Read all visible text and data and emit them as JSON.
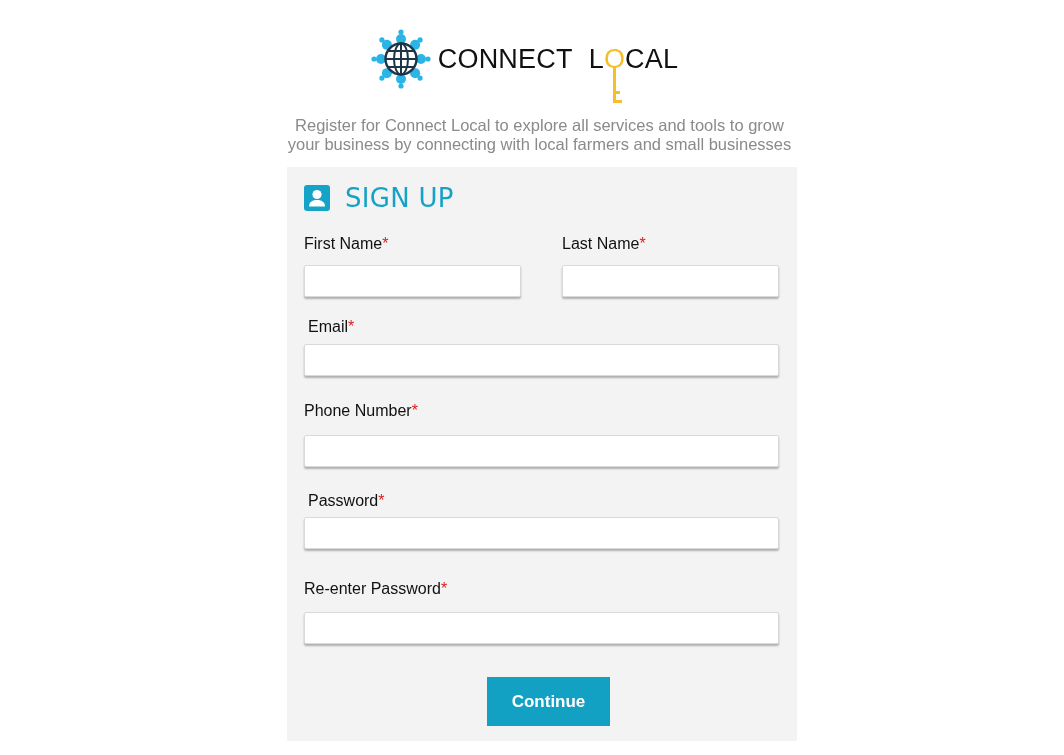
{
  "logo": {
    "first_word": "CONNECT",
    "second_word_parts": [
      {
        "kind": "plain",
        "text": "L"
      },
      {
        "kind": "key",
        "text": "O"
      },
      {
        "kind": "plain",
        "text": "CAL"
      }
    ]
  },
  "intro": "Register for Connect Local to explore all services and tools to grow your business by connecting with local farmers and small businesses",
  "form": {
    "title": "SIGN UP",
    "rows": [
      {
        "fields": [
          {
            "label": "First Name",
            "required_mark": "*"
          },
          {
            "label": "Last Name",
            "required_mark": "*"
          }
        ]
      },
      {
        "fields": [
          {
            "label": "Email",
            "required_mark": "*"
          }
        ]
      },
      {
        "fields": [
          {
            "label": "Phone Number",
            "required_mark": "*"
          }
        ]
      },
      {
        "fields": [
          {
            "label": "Password",
            "required_mark": "*"
          }
        ]
      },
      {
        "fields": [
          {
            "label": "Re-enter Password",
            "required_mark": "*"
          }
        ]
      }
    ],
    "submit": "Continue"
  }
}
